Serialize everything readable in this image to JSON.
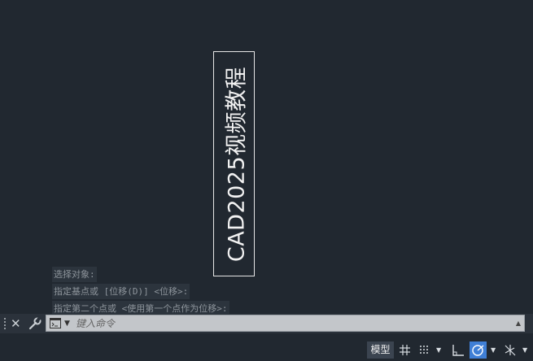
{
  "drawing": {
    "text_object": "CAD2025视频教程"
  },
  "command_history": [
    "选择对象:",
    "指定基点或 [位移(D)] <位移>:",
    "指定第二个点或 <使用第一个点作为位移>:"
  ],
  "command_line": {
    "placeholder": "键入命令",
    "value": ""
  },
  "status_bar": {
    "model_label": "模型"
  },
  "colors": {
    "canvas_bg": "#212830",
    "text_color": "#f2f2f2",
    "active_toggle": "#3f7fd6"
  },
  "icons": [
    "close-icon",
    "wrench-icon",
    "command-prompt-icon",
    "grid-icon",
    "snap-icon",
    "ortho-icon",
    "polar-tracking-icon",
    "isodraft-icon"
  ]
}
